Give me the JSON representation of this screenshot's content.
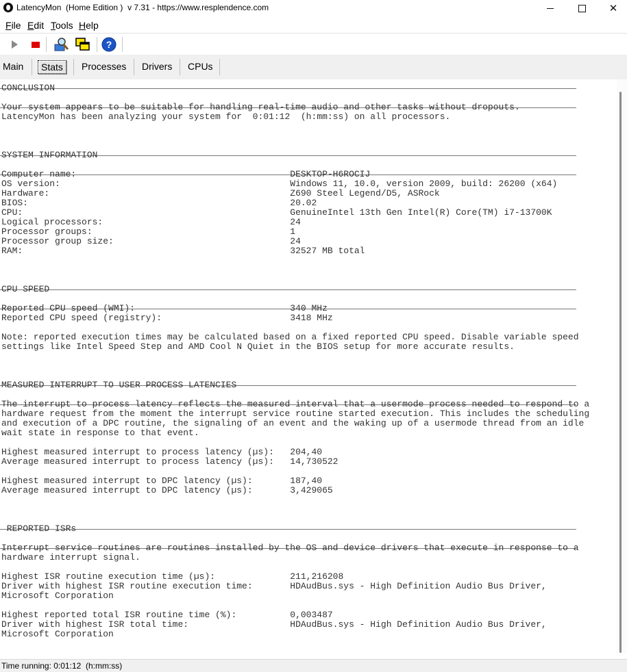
{
  "window": {
    "title": "LatencyMon  (Home Edition )  v 7.31 - https://www.resplendence.com",
    "minimize_icon": "minimize-icon",
    "maximize_icon": "maximize-icon",
    "close_icon": "close-icon"
  },
  "menu": [
    "File",
    "Edit",
    "Tools",
    "Help"
  ],
  "toolbar": {
    "icons": [
      "play-icon",
      "stop-icon",
      "search-icon",
      "windows-icon",
      "help-icon"
    ],
    "colors": {
      "stop": "#e00000",
      "help": "#1a55c8",
      "play": "#888888"
    }
  },
  "tabs": [
    "Main",
    "Stats",
    "Processes",
    "Drivers",
    "CPUs"
  ],
  "active_tab": "Stats",
  "report": {
    "conclusion_title": "CONCLUSION",
    "conclusion_text": "Your system appears to be suitable for handling real-time audio and other tasks without dropouts.\nLatencyMon has been analyzing your system for  0:01:12  (h:mm:ss) on all processors.",
    "sysinfo_title": "SYSTEM INFORMATION",
    "sysinfo_rows": [
      {
        "label": "Computer name:",
        "value": "DESKTOP-H6ROCIJ"
      },
      {
        "label": "OS version:",
        "value": "Windows 11, 10.0, version 2009, build: 26200 (x64)"
      },
      {
        "label": "Hardware:",
        "value": "Z690 Steel Legend/D5, ASRock"
      },
      {
        "label": "BIOS:",
        "value": "20.02"
      },
      {
        "label": "CPU:",
        "value": "GenuineIntel 13th Gen Intel(R) Core(TM) i7-13700K"
      },
      {
        "label": "Logical processors:",
        "value": "24"
      },
      {
        "label": "Processor groups:",
        "value": "1"
      },
      {
        "label": "Processor group size:",
        "value": "24"
      },
      {
        "label": "RAM:",
        "value": "32527 MB total"
      }
    ],
    "cpuspeed_title": "CPU SPEED",
    "cpuspeed_rows": [
      {
        "label": "Reported CPU speed (WMI):",
        "value": "340 MHz"
      },
      {
        "label": "Reported CPU speed (registry):",
        "value": "3418 MHz"
      }
    ],
    "cpuspeed_note": "Note: reported execution times may be calculated based on a fixed reported CPU speed. Disable variable speed\nsettings like Intel Speed Step and AMD Cool N Quiet in the BIOS setup for more accurate results.",
    "latency_title": "MEASURED INTERRUPT TO USER PROCESS LATENCIES",
    "latency_text": "The interrupt to process latency reflects the measured interval that a usermode process needed to respond to a\nhardware request from the moment the interrupt service routine started execution. This includes the scheduling\nand execution of a DPC routine, the signaling of an event and the waking up of a usermode thread from an idle\nwait state in response to that event.",
    "latency_rows1": [
      {
        "label": "Highest measured interrupt to process latency (µs):",
        "value": "204,40"
      },
      {
        "label": "Average measured interrupt to process latency (µs):",
        "value": "14,730522"
      }
    ],
    "latency_rows2": [
      {
        "label": "Highest measured interrupt to DPC latency (µs):",
        "value": "187,40"
      },
      {
        "label": "Average measured interrupt to DPC latency (µs):",
        "value": "3,429065"
      }
    ],
    "isr_title": " REPORTED ISRs",
    "isr_text": "Interrupt service routines are routines installed by the OS and device drivers that execute in response to a\nhardware interrupt signal.",
    "isr_rows1": [
      {
        "label": "Highest ISR routine execution time (µs):",
        "value": "211,216208"
      },
      {
        "label": "Driver with highest ISR routine execution time:",
        "value": "HDAudBus.sys - High Definition Audio Bus Driver,"
      }
    ],
    "isr_cont1": "Microsoft Corporation",
    "isr_rows2": [
      {
        "label": "Highest reported total ISR routine time (%):",
        "value": "0,003487"
      },
      {
        "label": "Driver with highest ISR total time:",
        "value": "HDAudBus.sys - High Definition Audio Bus Driver,"
      }
    ],
    "isr_cont2": "Microsoft Corporation"
  },
  "status": {
    "text": "Time running: 0:01:12  (h:mm:ss)"
  }
}
